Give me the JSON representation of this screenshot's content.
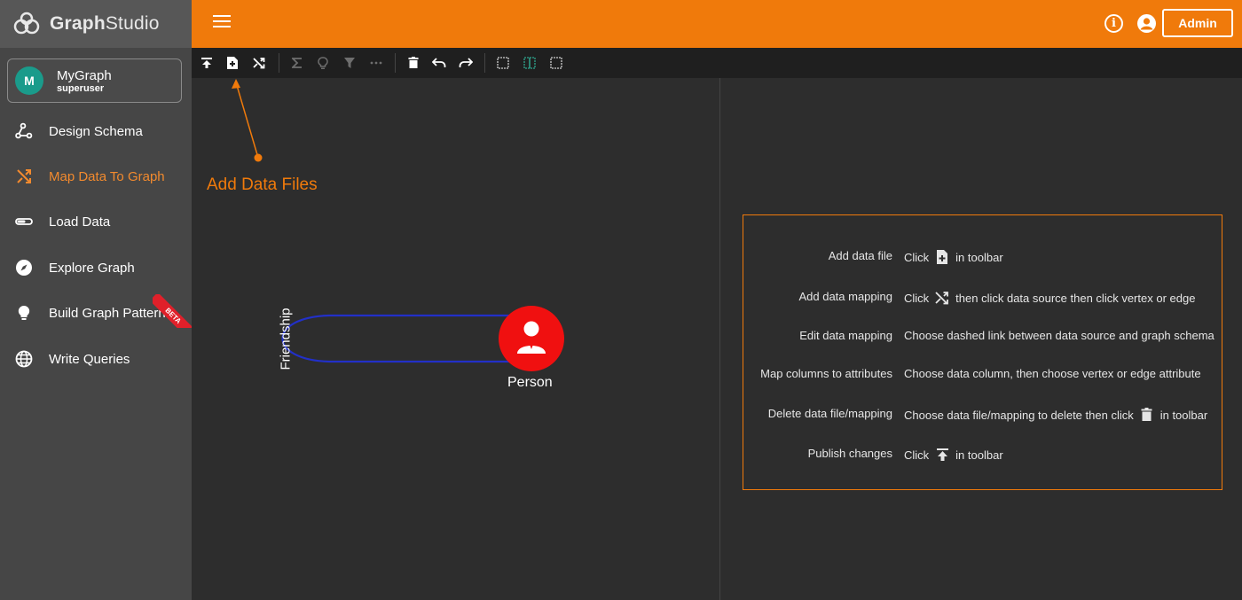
{
  "app": {
    "logo_text_1": "Graph",
    "logo_text_2": "Studio"
  },
  "graph_card": {
    "avatar_letter": "M",
    "name": "MyGraph",
    "role": "superuser"
  },
  "sidebar": {
    "items": [
      {
        "label": "Design Schema",
        "icon": "schema-icon"
      },
      {
        "label": "Map Data To Graph",
        "icon": "shuffle-icon",
        "active": true
      },
      {
        "label": "Load Data",
        "icon": "load-icon"
      },
      {
        "label": "Explore Graph",
        "icon": "compass-icon"
      },
      {
        "label": "Build Graph Patterns",
        "icon": "lightbulb-icon"
      },
      {
        "label": "Write Queries",
        "icon": "globe-icon"
      }
    ],
    "beta_badge": "BETA"
  },
  "topbar": {
    "admin_label": "Admin"
  },
  "canvas": {
    "annotation": "Add Data Files",
    "vertex_label": "Person",
    "edge_label": "Friendship",
    "vertex_color": "#f01010",
    "edge_color": "#2230c8"
  },
  "help": {
    "rows": [
      {
        "key": "Add data file",
        "pre": "Click",
        "icon": "add-file-icon",
        "post": "in toolbar"
      },
      {
        "key": "Add data mapping",
        "pre": "Click",
        "icon": "shuffle-icon",
        "post": "then click data source then click vertex or edge"
      },
      {
        "key": "Edit data mapping",
        "pre": "Choose dashed link between data source and graph schema",
        "icon": "",
        "post": ""
      },
      {
        "key": "Map columns to attributes",
        "pre": "Choose data column, then choose vertex or edge attribute",
        "icon": "",
        "post": ""
      },
      {
        "key": "Delete data file/mapping",
        "pre": "Choose data file/mapping to delete then click",
        "icon": "trash-icon",
        "post": "in toolbar"
      },
      {
        "key": "Publish changes",
        "pre": "Click",
        "icon": "publish-icon",
        "post": "in toolbar"
      }
    ]
  },
  "colors": {
    "accent": "#f07a0b",
    "sidebar_bg": "#464646",
    "canvas_bg": "#2d2d2d"
  }
}
